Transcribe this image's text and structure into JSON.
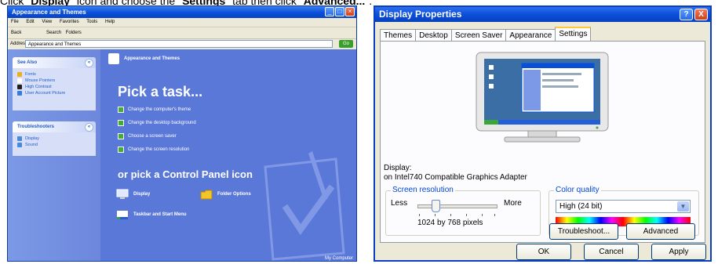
{
  "caption": {
    "prefix": "Click \"",
    "display": "Display",
    "middle": "\" icon and choose the \"",
    "settings": "Settings",
    "middle2": "\" tab then click \"",
    "advanced": "Advanced...",
    "suffix": "\"."
  },
  "left_window": {
    "title": "Appearance and Themes",
    "menu": [
      "File",
      "Edit",
      "View",
      "Favorites",
      "Tools",
      "Help"
    ],
    "toolbar": [
      "Back",
      "Search",
      "Folders"
    ],
    "address_label": "Address",
    "address_value": "Appearance and Themes",
    "go_label": "Go",
    "see_also": {
      "title": "See Also",
      "items": [
        "Fonts",
        "Mouse Pointers",
        "High Contrast",
        "User Account Picture"
      ]
    },
    "troubleshooters": {
      "title": "Troubleshooters",
      "items": [
        "Display",
        "Sound"
      ]
    },
    "header": "Appearance and Themes",
    "pick_task": "Pick a task...",
    "tasks": [
      "Change the computer's theme",
      "Change the desktop background",
      "Choose a screen saver",
      "Change the screen resolution"
    ],
    "or_pick": "or pick a Control Panel icon",
    "icons": [
      "Display",
      "Folder Options",
      "Taskbar and Start Menu"
    ],
    "status_right": "My Computer"
  },
  "dialog": {
    "title": "Display Properties",
    "help_btn": "?",
    "close_btn": "X",
    "tabs": [
      "Themes",
      "Desktop",
      "Screen Saver",
      "Appearance",
      "Settings"
    ],
    "active_tab": "Settings",
    "display_label": "Display:",
    "display_value": "on Intel740 Compatible Graphics Adapter",
    "resolution": {
      "title": "Screen resolution",
      "less": "Less",
      "more": "More",
      "value": "1024 by 768 pixels"
    },
    "color_quality": {
      "title": "Color quality",
      "value": "High (24 bit)"
    },
    "troubleshoot_btn": "Troubleshoot...",
    "advanced_btn": "Advanced",
    "ok_btn": "OK",
    "cancel_btn": "Cancel",
    "apply_btn": "Apply"
  }
}
